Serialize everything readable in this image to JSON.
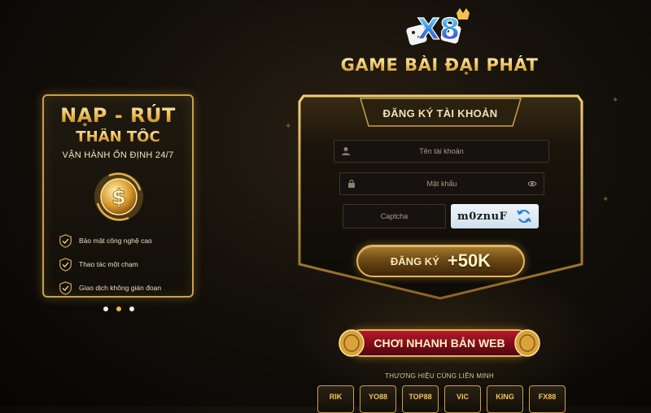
{
  "site": {
    "title": "GAME BÀI ĐẠI PHÁT",
    "logo_text": "X8"
  },
  "promo": {
    "title": "NẠP - RÚT",
    "subtitle": "THẦN TỐC",
    "tagline": "VẬN HÀNH ỔN ĐỊNH 24/7",
    "coin_symbol": "$",
    "features": [
      {
        "icon": "shield-check-icon",
        "label": "Bảo mật công nghệ cao"
      },
      {
        "icon": "shield-check-icon",
        "label": "Thao tác một chạm"
      },
      {
        "icon": "shield-check-icon",
        "label": "Giao dịch không gián đoạn"
      }
    ],
    "carousel": {
      "count": 3,
      "active_index": 1
    }
  },
  "register": {
    "heading": "ĐĂNG KÝ TÀI KHOẢN",
    "username_placeholder": "Tên tài khoản",
    "password_placeholder": "Mật khẩu",
    "captcha_placeholder": "Captcha",
    "captcha_code": "m0znuF",
    "button_label": "ĐĂNG KÝ",
    "button_bonus": "+50K"
  },
  "web_play": {
    "label": "CHƠI NHANH BẢN WEB"
  },
  "alliance": {
    "title": "THƯƠNG HIỆU CÙNG LIÊN MINH",
    "brands": [
      "RIK",
      "YO88",
      "TOP88",
      "VIC",
      "KING",
      "FX88"
    ]
  },
  "colors": {
    "gold": "#e3b659",
    "dark_bg": "#0b0906",
    "red_button": "#8b1020"
  }
}
